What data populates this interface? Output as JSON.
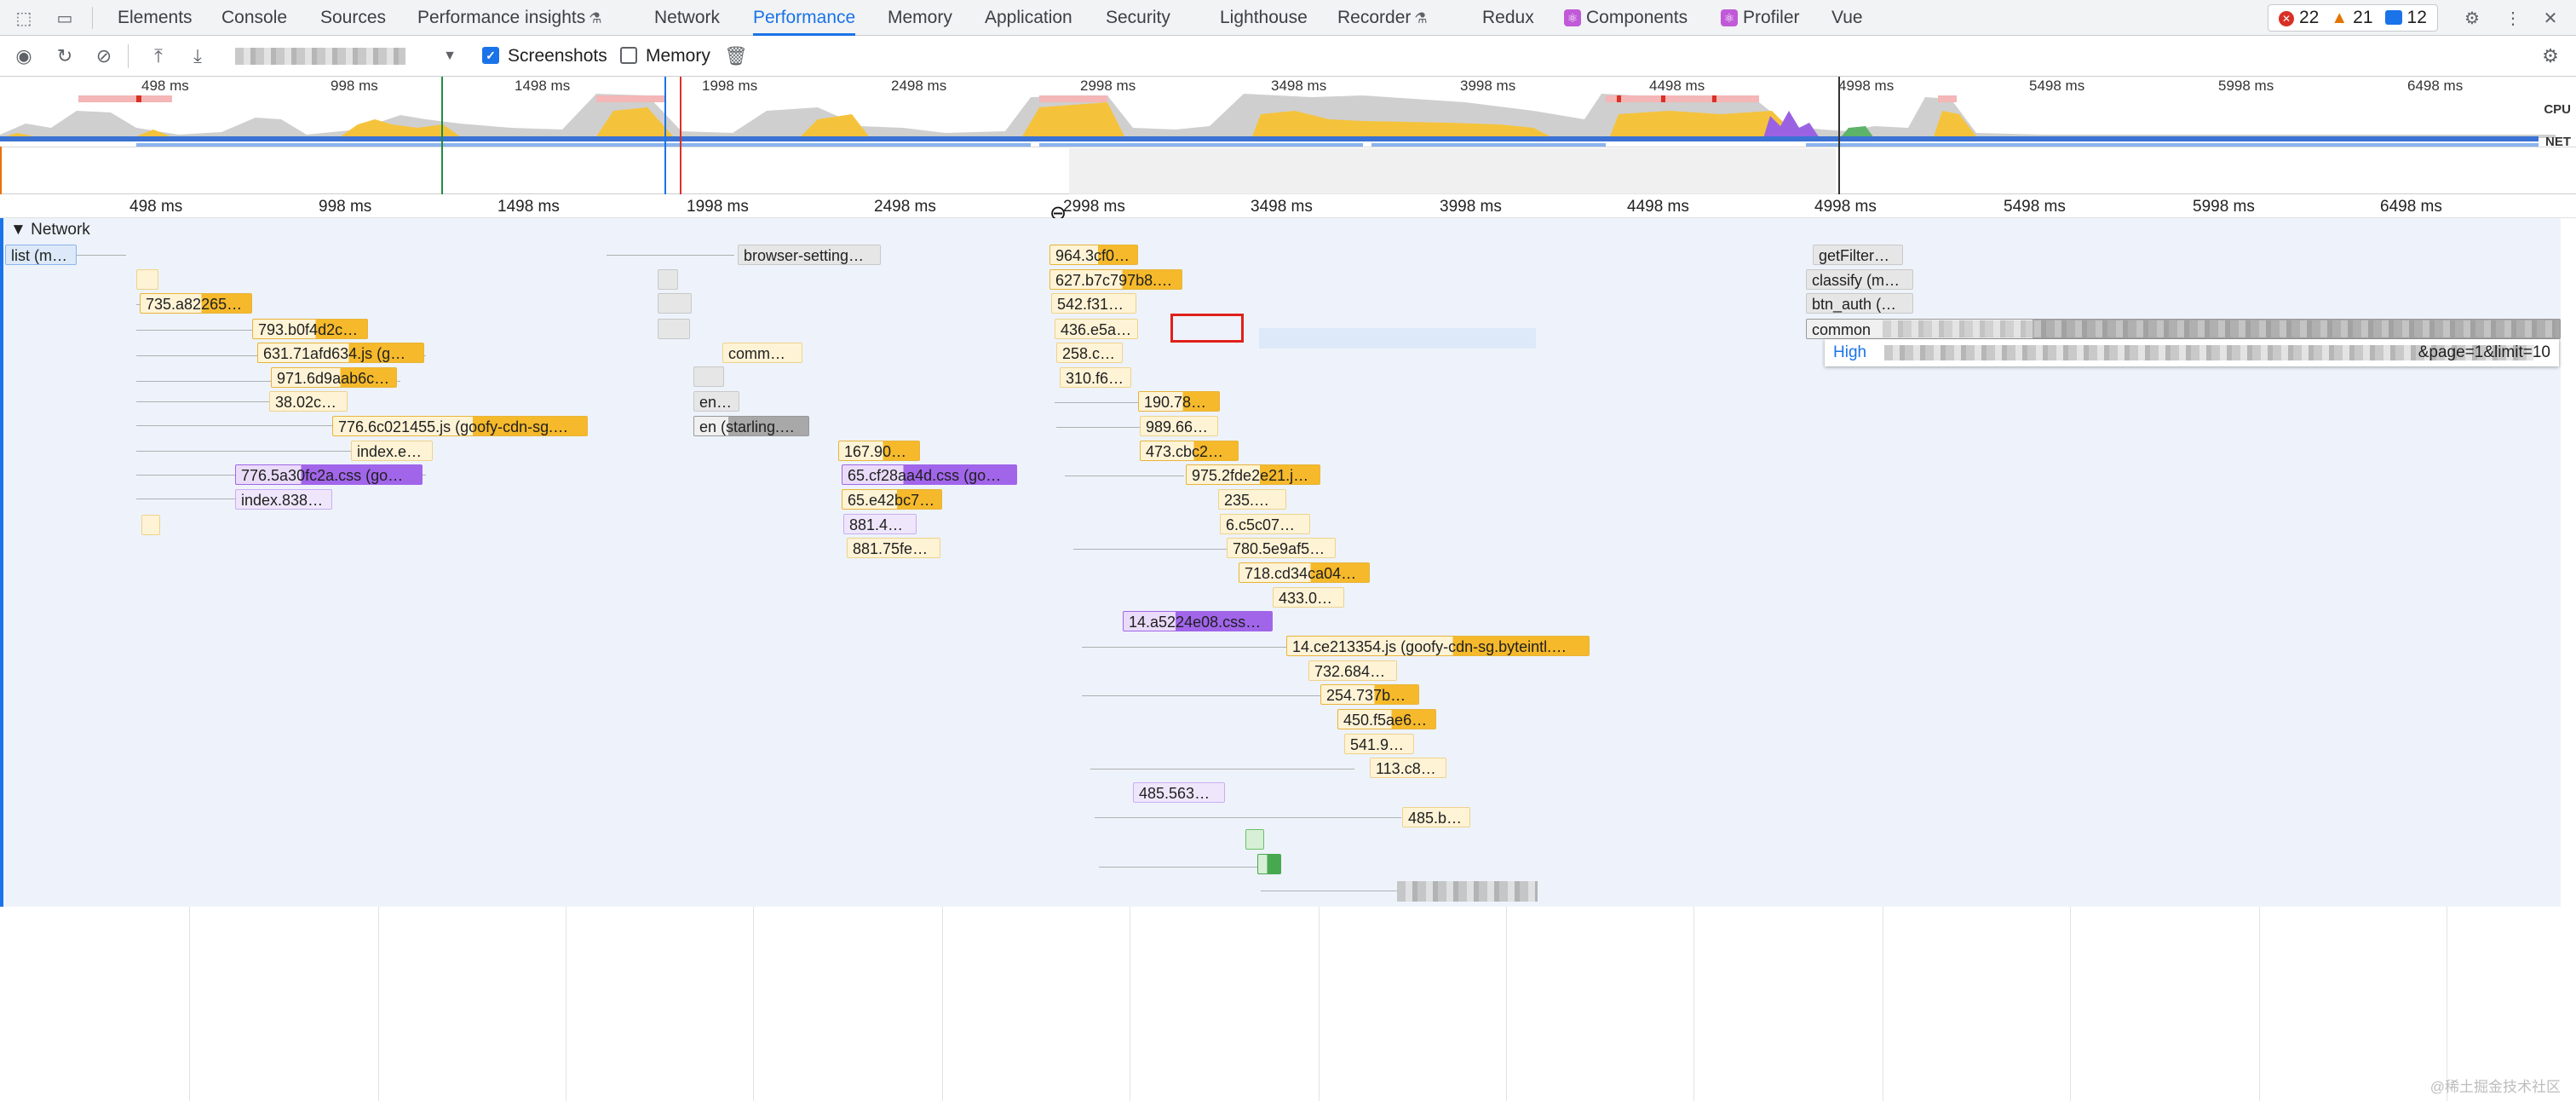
{
  "tabs": {
    "items": [
      "Elements",
      "Console",
      "Sources",
      "Performance insights",
      "Network",
      "Performance",
      "Memory",
      "Application",
      "Security",
      "Lighthouse",
      "Recorder",
      "Redux",
      "Components",
      "Profiler",
      "Vue"
    ],
    "active": "Performance"
  },
  "counters": {
    "errors": "22",
    "warnings": "21",
    "messages": "12"
  },
  "toolbar": {
    "screenshots_label": "Screenshots",
    "screenshots_checked": true,
    "memory_label": "Memory",
    "memory_checked": false
  },
  "overview": {
    "ticks": [
      "498 ms",
      "998 ms",
      "1498 ms",
      "1998 ms",
      "2498 ms",
      "2998 ms",
      "3498 ms",
      "3998 ms",
      "4498 ms",
      "4998 ms",
      "5498 ms",
      "5998 ms",
      "6498 ms"
    ],
    "cpu_label": "CPU",
    "net_label": "NET"
  },
  "timeline": {
    "ticks": [
      "498 ms",
      "998 ms",
      "1498 ms",
      "1998 ms",
      "2498 ms",
      "2998 ms",
      "3498 ms",
      "3998 ms",
      "4498 ms",
      "4998 ms",
      "5498 ms",
      "5998 ms",
      "6498 ms"
    ],
    "track_title": "Network"
  },
  "requests": [
    {
      "label": "list (m…",
      "style": "bl"
    },
    {
      "label": "735.a82265…",
      "style": "y"
    },
    {
      "label": "793.b0f4d2c…",
      "style": "y"
    },
    {
      "label": "631.71afd634.js (g…",
      "style": "y"
    },
    {
      "label": "971.6d9aab6c…",
      "style": "y"
    },
    {
      "label": "38.02c…",
      "style": "y"
    },
    {
      "label": "776.6c021455.js (goofy-cdn-sg.…",
      "style": "y"
    },
    {
      "label": "index.e…",
      "style": "yl"
    },
    {
      "label": "776.5a30fc2a.css (go…",
      "style": "p"
    },
    {
      "label": "index.838…",
      "style": "pl"
    },
    {
      "label": "browser-setting…",
      "style": "g"
    },
    {
      "label": "comm…",
      "style": "yl"
    },
    {
      "label": "en…",
      "style": "g"
    },
    {
      "label": "en (starling.…",
      "style": "gd"
    },
    {
      "label": "167.90…",
      "style": "y"
    },
    {
      "label": "65.cf28aa4d.css (go…",
      "style": "p"
    },
    {
      "label": "65.e42bc7…",
      "style": "y"
    },
    {
      "label": "881.4…",
      "style": "pl"
    },
    {
      "label": "881.75fe…",
      "style": "yl"
    },
    {
      "label": "964.3cf0…",
      "style": "y"
    },
    {
      "label": "627.b7c797b8.…",
      "style": "y"
    },
    {
      "label": "542.f31…",
      "style": "yl"
    },
    {
      "label": "436.e5a…",
      "style": "yl"
    },
    {
      "label": "258.c…",
      "style": "yl"
    },
    {
      "label": "310.f6…",
      "style": "yl"
    },
    {
      "label": "190.78…",
      "style": "y"
    },
    {
      "label": "989.66…",
      "style": "yl"
    },
    {
      "label": "473.cbc2…",
      "style": "y"
    },
    {
      "label": "975.2fde2e21.j…",
      "style": "y"
    },
    {
      "label": "235.…",
      "style": "yl"
    },
    {
      "label": "6.c5c07…",
      "style": "yl"
    },
    {
      "label": "780.5e9af5…",
      "style": "yl"
    },
    {
      "label": "718.cd34ca04…",
      "style": "y"
    },
    {
      "label": "433.0…",
      "style": "yl"
    },
    {
      "label": "14.a5224e08.css…",
      "style": "p"
    },
    {
      "label": "14.ce213354.js (goofy-cdn-sg.byteintl.…",
      "style": "y"
    },
    {
      "label": "732.684…",
      "style": "yl"
    },
    {
      "label": "254.737b…",
      "style": "y"
    },
    {
      "label": "450.f5ae6…",
      "style": "y"
    },
    {
      "label": "541.9…",
      "style": "yl"
    },
    {
      "label": "113.c8…",
      "style": "yl"
    },
    {
      "label": "485.563…",
      "style": "pl"
    },
    {
      "label": "485.b…",
      "style": "yl"
    },
    {
      "label": "getFilter…",
      "style": "g"
    },
    {
      "label": "classify (m…",
      "style": "g"
    },
    {
      "label": "btn_auth (…",
      "style": "g"
    },
    {
      "label": "common",
      "style": "gd"
    }
  ],
  "tooltip": {
    "priority": "High",
    "url_tail": "&page=1&limit=10"
  },
  "watermark": "@稀土掘金技术社区"
}
